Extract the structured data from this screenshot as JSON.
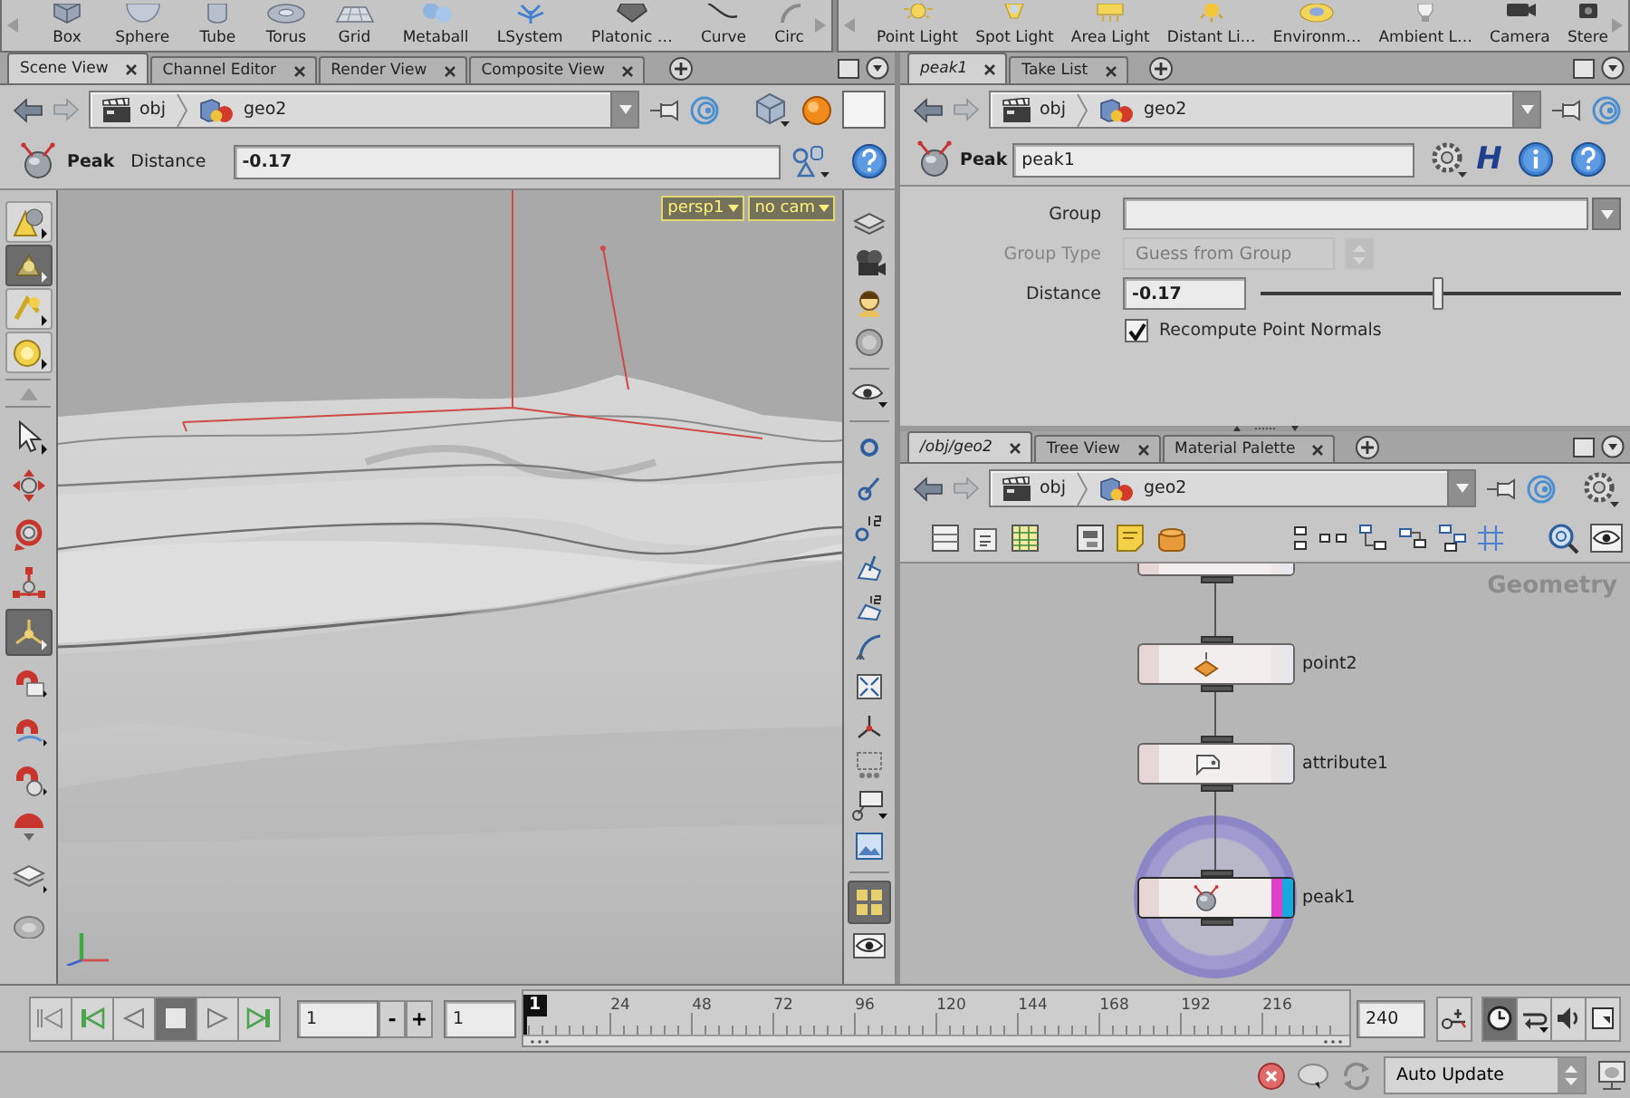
{
  "shelves": [
    {
      "tools": [
        {
          "label": "Box",
          "kind": "box"
        },
        {
          "label": "Sphere",
          "kind": "sphere"
        },
        {
          "label": "Tube",
          "kind": "tube"
        },
        {
          "label": "Torus",
          "kind": "torus"
        },
        {
          "label": "Grid",
          "kind": "grid"
        },
        {
          "label": "Metaball",
          "kind": "metaball"
        },
        {
          "label": "LSystem",
          "kind": "lsystem"
        },
        {
          "label": "Platonic …",
          "kind": "platonic"
        },
        {
          "label": "Curve",
          "kind": "curve"
        },
        {
          "label": "Circ",
          "kind": "circle"
        }
      ]
    },
    {
      "tools": [
        {
          "label": "Point Light",
          "kind": "pointlight"
        },
        {
          "label": "Spot Light",
          "kind": "spotlight"
        },
        {
          "label": "Area Light",
          "kind": "arealight"
        },
        {
          "label": "Distant Li…",
          "kind": "distantlight"
        },
        {
          "label": "Environm…",
          "kind": "envlight"
        },
        {
          "label": "Ambient L…",
          "kind": "ambientlight"
        },
        {
          "label": "Camera",
          "kind": "camera"
        },
        {
          "label": "Stere",
          "kind": "stereocamera"
        }
      ]
    }
  ],
  "scene_view": {
    "tabs": [
      {
        "label": "Scene View",
        "selected": true,
        "follows_selection": false
      },
      {
        "label": "Channel Editor",
        "selected": false,
        "follows_selection": false
      },
      {
        "label": "Render View",
        "selected": false,
        "follows_selection": false
      },
      {
        "label": "Composite View",
        "selected": false,
        "follows_selection": false
      }
    ],
    "path": [
      {
        "label": "obj",
        "kind": "network"
      },
      {
        "label": "geo2",
        "kind": "geometry"
      }
    ],
    "operation": {
      "title": "Peak",
      "parameter": "Distance",
      "value": "-0.17"
    },
    "viewport": {
      "camera_menu": "persp1",
      "view_menu": "no cam"
    },
    "left_tools": [
      {
        "kind": "points",
        "selected": false
      },
      {
        "kind": "primitives",
        "selected": true
      },
      {
        "kind": "edges",
        "selected": false
      },
      {
        "kind": "groups",
        "selected": false
      },
      {
        "kind": "select",
        "selected": false
      },
      {
        "kind": "move",
        "selected": false
      },
      {
        "kind": "rotate",
        "selected": false
      },
      {
        "kind": "scale",
        "selected": false
      },
      {
        "kind": "handle",
        "selected": true
      },
      {
        "kind": "magnet-move",
        "selected": false
      },
      {
        "kind": "magnet-rotate",
        "selected": false
      },
      {
        "kind": "magnet-scale",
        "selected": false
      },
      {
        "kind": "dome",
        "selected": false
      },
      {
        "kind": "sheets",
        "selected": false
      },
      {
        "kind": "view",
        "selected": false
      }
    ],
    "right_tools": [
      {
        "kind": "layers",
        "selected": false
      },
      {
        "kind": "camera",
        "selected": false
      },
      {
        "kind": "headlight",
        "selected": false
      },
      {
        "kind": "ghost",
        "selected": false
      },
      {
        "kind": "visibility",
        "selected": false
      },
      {
        "kind": "point-marker",
        "selected": false
      },
      {
        "kind": "point-normal",
        "selected": false
      },
      {
        "kind": "point-number",
        "selected": false
      },
      {
        "kind": "prim-normal",
        "selected": false
      },
      {
        "kind": "prim-number",
        "selected": false
      },
      {
        "kind": "curve",
        "selected": false
      },
      {
        "kind": "frame",
        "selected": false
      },
      {
        "kind": "axes",
        "selected": false
      },
      {
        "kind": "text",
        "selected": false
      },
      {
        "kind": "callout",
        "selected": false
      },
      {
        "kind": "background",
        "selected": false
      },
      {
        "kind": "grid",
        "selected": true
      },
      {
        "kind": "eye",
        "selected": false
      }
    ]
  },
  "parameters": {
    "tabs": [
      {
        "label": "peak1",
        "selected": true,
        "follows_selection": true
      },
      {
        "label": "Take List",
        "selected": false,
        "follows_selection": false
      }
    ],
    "path": [
      {
        "label": "obj",
        "kind": "network"
      },
      {
        "label": "geo2",
        "kind": "geometry"
      }
    ],
    "node_type": "Peak",
    "node_name": "peak1",
    "asset_menu": "H",
    "params": [
      {
        "kind": "menu-field",
        "label": "Group",
        "disabled": false
      },
      {
        "kind": "menu",
        "label": "Group Type",
        "value": "Guess from Group",
        "disabled": true
      },
      {
        "kind": "slider",
        "label": "Distance",
        "value": "-0.17",
        "level": 0.49,
        "disabled": false
      },
      {
        "kind": "checkbox",
        "label": "Recompute Point Normals",
        "checked": true,
        "disabled": false
      }
    ]
  },
  "network": {
    "tabs": [
      {
        "label": "/obj/geo2",
        "selected": true,
        "follows_selection": true
      },
      {
        "label": "Tree View",
        "selected": false,
        "follows_selection": false
      },
      {
        "label": "Material Palette",
        "selected": false,
        "follows_selection": false
      }
    ],
    "path": [
      {
        "label": "obj",
        "kind": "network"
      },
      {
        "label": "geo2",
        "kind": "geometry"
      }
    ],
    "context": "Geometry",
    "nodes": [
      {
        "cut_off": true,
        "selected": false,
        "display": false,
        "render": false
      },
      {
        "name": "point2",
        "kind": "point",
        "cut_off": false,
        "selected": false,
        "display": false,
        "render": false
      },
      {
        "name": "attribute1",
        "kind": "attribute",
        "cut_off": false,
        "selected": false,
        "display": false,
        "render": false
      },
      {
        "name": "peak1",
        "kind": "peak",
        "cut_off": false,
        "selected": true,
        "display": true,
        "render": true
      }
    ]
  },
  "playbar": {
    "playback": [
      {
        "kind": "first",
        "selected": false
      },
      {
        "kind": "back",
        "selected": false
      },
      {
        "kind": "reverse",
        "selected": false
      },
      {
        "kind": "stop",
        "selected": true
      },
      {
        "kind": "play",
        "selected": false
      },
      {
        "kind": "last",
        "selected": false
      }
    ],
    "current_frame": "1",
    "step_buttons": [
      "-",
      "+"
    ],
    "start_frame": "1",
    "frame_marker": "1",
    "ticks": [
      "24",
      "48",
      "72",
      "96",
      "120",
      "144",
      "168",
      "192",
      "216"
    ],
    "end_frame": "240",
    "options": [
      {
        "kind": "key",
        "selected": false
      },
      {
        "kind": "realtime",
        "selected": true
      },
      {
        "kind": "loop",
        "selected": false
      },
      {
        "kind": "audio",
        "selected": false
      },
      {
        "kind": "range",
        "selected": false
      }
    ]
  },
  "status_bar": {
    "update_mode": "Auto Update"
  }
}
